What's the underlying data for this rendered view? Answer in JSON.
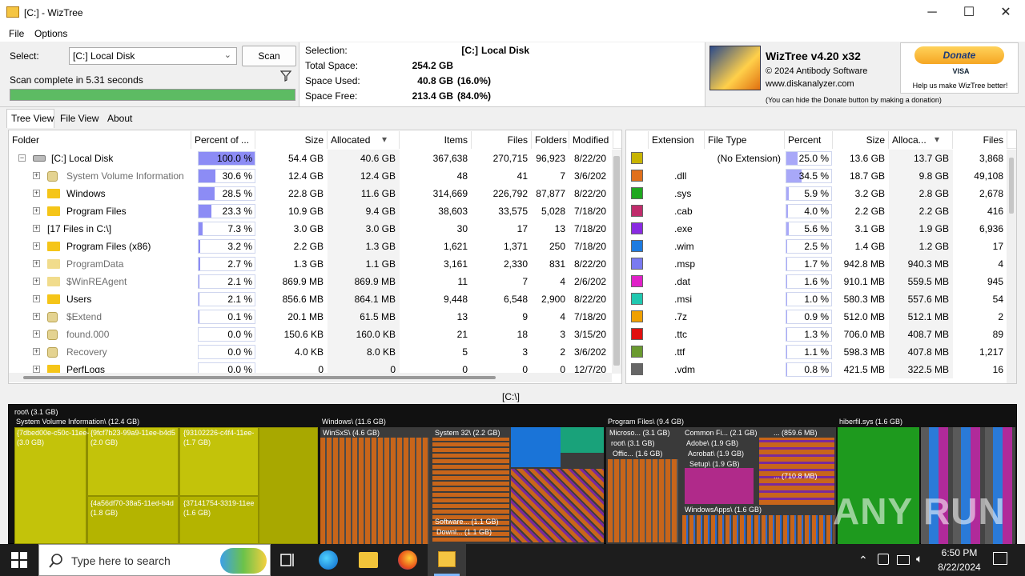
{
  "window": {
    "title": "[C:]  - WizTree",
    "minimize": "─",
    "maximize": "☐",
    "close": "✕"
  },
  "menu": [
    "File",
    "Options"
  ],
  "select": {
    "label": "Select:",
    "drive": "[C:] Local Disk",
    "scan_label": "Scan",
    "status": "Scan complete in 5.31 seconds",
    "progress": 1.0
  },
  "info": {
    "selection_label": "Selection:",
    "selection_drive": "[C:]",
    "selection_name": "Local Disk",
    "total_label": "Total Space:",
    "total": "254.2 GB",
    "used_label": "Space Used:",
    "used": "40.8 GB",
    "used_pct": "(16.0%)",
    "free_label": "Space Free:",
    "free": "213.4 GB",
    "free_pct": "(84.0%)"
  },
  "about": {
    "version": "WizTree v4.20 x32",
    "copyright": "© 2024 Antibody Software",
    "site": "www.diskanalyzer.com",
    "hide_note": "(You can hide the Donate button by making a donation)"
  },
  "donate": {
    "label": "Donate",
    "cards": "VISA",
    "help": "Help us make WizTree better!"
  },
  "tabs": [
    "Tree View",
    "File View",
    "About"
  ],
  "tree": {
    "columns": [
      "Folder",
      "Percent of ...",
      "Size",
      "Allocated",
      "Items",
      "Files",
      "Folders",
      "Modified"
    ],
    "rows": [
      {
        "name": "[C:] Local Disk",
        "pct": "100.0 %",
        "pctv": 1.0,
        "size": "54.4 GB",
        "alloc": "40.6 GB",
        "items": "367,638",
        "files": "270,715",
        "folders": "96,923",
        "mod": "8/22/20",
        "icon": "drive"
      },
      {
        "name": "System Volume Information",
        "pct": "30.6 %",
        "pctv": 0.306,
        "size": "12.4 GB",
        "alloc": "12.4 GB",
        "items": "48",
        "files": "41",
        "folders": "7",
        "mod": "3/6/202",
        "icon": "sys",
        "dim": true
      },
      {
        "name": "Windows",
        "pct": "28.5 %",
        "pctv": 0.285,
        "size": "22.8 GB",
        "alloc": "11.6 GB",
        "items": "314,669",
        "files": "226,792",
        "folders": "87,877",
        "mod": "8/22/20",
        "icon": "folder"
      },
      {
        "name": "Program Files",
        "pct": "23.3 %",
        "pctv": 0.233,
        "size": "10.9 GB",
        "alloc": "9.4 GB",
        "items": "38,603",
        "files": "33,575",
        "folders": "5,028",
        "mod": "7/18/20",
        "icon": "folder"
      },
      {
        "name": "[17 Files in C:\\]",
        "pct": "7.3 %",
        "pctv": 0.073,
        "size": "3.0 GB",
        "alloc": "3.0 GB",
        "items": "30",
        "files": "17",
        "folders": "13",
        "mod": "7/18/20",
        "icon": "none"
      },
      {
        "name": "Program Files (x86)",
        "pct": "3.2 %",
        "pctv": 0.032,
        "size": "2.2 GB",
        "alloc": "1.3 GB",
        "items": "1,621",
        "files": "1,371",
        "folders": "250",
        "mod": "7/18/20",
        "icon": "folder"
      },
      {
        "name": "ProgramData",
        "pct": "2.7 %",
        "pctv": 0.027,
        "size": "1.3 GB",
        "alloc": "1.1 GB",
        "items": "3,161",
        "files": "2,330",
        "folders": "831",
        "mod": "8/22/20",
        "icon": "folderdim",
        "dim": true
      },
      {
        "name": "$WinREAgent",
        "pct": "2.1 %",
        "pctv": 0.021,
        "size": "869.9 MB",
        "alloc": "869.9 MB",
        "items": "11",
        "files": "7",
        "folders": "4",
        "mod": "2/6/202",
        "icon": "folderdim",
        "dim": true
      },
      {
        "name": "Users",
        "pct": "2.1 %",
        "pctv": 0.021,
        "size": "856.6 MB",
        "alloc": "864.1 MB",
        "items": "9,448",
        "files": "6,548",
        "folders": "2,900",
        "mod": "8/22/20",
        "icon": "folder"
      },
      {
        "name": "$Extend",
        "pct": "0.1 %",
        "pctv": 0.001,
        "size": "20.1 MB",
        "alloc": "61.5 MB",
        "items": "13",
        "files": "9",
        "folders": "4",
        "mod": "7/18/20",
        "icon": "sys",
        "dim": true
      },
      {
        "name": "found.000",
        "pct": "0.0 %",
        "pctv": 0.0,
        "size": "150.6 KB",
        "alloc": "160.0 KB",
        "items": "21",
        "files": "18",
        "folders": "3",
        "mod": "3/15/20",
        "icon": "sys",
        "dim": true
      },
      {
        "name": "Recovery",
        "pct": "0.0 %",
        "pctv": 0.0,
        "size": "4.0 KB",
        "alloc": "8.0 KB",
        "items": "5",
        "files": "3",
        "folders": "2",
        "mod": "3/6/202",
        "icon": "sys",
        "dim": true
      },
      {
        "name": "PerfLogs",
        "pct": "0.0 %",
        "pctv": 0.0,
        "size": "0",
        "alloc": "0",
        "items": "0",
        "files": "0",
        "folders": "0",
        "mod": "12/7/20",
        "icon": "folder"
      }
    ]
  },
  "ext": {
    "columns": [
      "Extension",
      "File Type",
      "Percent",
      "Size",
      "Alloca...",
      "Files"
    ],
    "rows": [
      {
        "ext": "",
        "type": "(No Extension)",
        "pct": "25.0 %",
        "pctv": 0.25,
        "size": "13.6 GB",
        "alloc": "13.7 GB",
        "files": "3,868",
        "color": "#c8b400"
      },
      {
        "ext": ".dll",
        "type": "",
        "pct": "34.5 %",
        "pctv": 0.345,
        "size": "18.7 GB",
        "alloc": "9.8 GB",
        "files": "49,108",
        "color": "#e0701c"
      },
      {
        "ext": ".sys",
        "type": "",
        "pct": "5.9 %",
        "pctv": 0.059,
        "size": "3.2 GB",
        "alloc": "2.8 GB",
        "files": "2,678",
        "color": "#1fa81f"
      },
      {
        "ext": ".cab",
        "type": "",
        "pct": "4.0 %",
        "pctv": 0.04,
        "size": "2.2 GB",
        "alloc": "2.2 GB",
        "files": "416",
        "color": "#c02c6c"
      },
      {
        "ext": ".exe",
        "type": "",
        "pct": "5.6 %",
        "pctv": 0.056,
        "size": "3.1 GB",
        "alloc": "1.9 GB",
        "files": "6,936",
        "color": "#8a2be2"
      },
      {
        "ext": ".wim",
        "type": "",
        "pct": "2.5 %",
        "pctv": 0.025,
        "size": "1.4 GB",
        "alloc": "1.2 GB",
        "files": "17",
        "color": "#1e7be0"
      },
      {
        "ext": ".msp",
        "type": "",
        "pct": "1.7 %",
        "pctv": 0.017,
        "size": "942.8 MB",
        "alloc": "940.3 MB",
        "files": "4",
        "color": "#7a7af0"
      },
      {
        "ext": ".dat",
        "type": "",
        "pct": "1.6 %",
        "pctv": 0.016,
        "size": "910.1 MB",
        "alloc": "559.5 MB",
        "files": "945",
        "color": "#e020c8"
      },
      {
        "ext": ".msi",
        "type": "",
        "pct": "1.0 %",
        "pctv": 0.01,
        "size": "580.3 MB",
        "alloc": "557.6 MB",
        "files": "54",
        "color": "#20c8b0"
      },
      {
        "ext": ".7z",
        "type": "",
        "pct": "0.9 %",
        "pctv": 0.009,
        "size": "512.0 MB",
        "alloc": "512.1 MB",
        "files": "2",
        "color": "#f0a000"
      },
      {
        "ext": ".ttc",
        "type": "",
        "pct": "1.3 %",
        "pctv": 0.013,
        "size": "706.0 MB",
        "alloc": "408.7 MB",
        "files": "89",
        "color": "#e01010"
      },
      {
        "ext": ".ttf",
        "type": "",
        "pct": "1.1 %",
        "pctv": 0.011,
        "size": "598.3 MB",
        "alloc": "407.8 MB",
        "files": "1,217",
        "color": "#6a9a30"
      },
      {
        "ext": ".vdm",
        "type": "",
        "pct": "0.8 %",
        "pctv": 0.008,
        "size": "421.5 MB",
        "alloc": "322.5 MB",
        "files": "16",
        "color": "#666666"
      }
    ]
  },
  "path": "[C:\\]",
  "treemap": {
    "root": "root\\  (3.1 GB)",
    "svi": "System Volume Information\\  (12.4 GB)",
    "svi1": "{7dbed00e-c50c-11ee-",
    "svi1s": "(3.0 GB)",
    "svi2": "{9fcf7b23-99a9-11ee-b4d5",
    "svi2s": "(2.0 GB)",
    "svi3": "{93102226-c4f4-11ee-",
    "svi3s": "(1.7 GB)",
    "svi4": "{4a56df70-38a5-11ed-b4d",
    "svi4s": "(1.8 GB)",
    "svi5": "{37141754-3319-11ee",
    "svi5s": "(1.6 GB)",
    "windows": "Windows\\  (11.6 GB)",
    "winsxs": "WinSxS\\  (4.6 GB)",
    "system32": "System 32\\  (2.2 GB)",
    "software": "Software...  (1.1 GB)",
    "downl": "Downl...  (1.1 GB)",
    "pf": "Program Files\\  (9.4 GB)",
    "micro": "Microso...  (3.1 GB)",
    "offic": "Offic...  (1.6 GB)",
    "common": "Common Fi...  (2.1 GB)",
    "adobe": "Adobe\\  (1.9 GB)",
    "acrobat": "Acrobat\\  (1.9 GB)",
    "setup": "Setup\\  (1.9 GB)",
    "dots1": "...  (859.6 MB)",
    "dots2": "...  (710.8 MB)",
    "winapps": "WindowsApps\\  (1.6 GB)",
    "hiber": "hiberfil.sys  (1.6 GB)"
  },
  "taskbar": {
    "search_placeholder": "Type here to search",
    "time": "6:50 PM",
    "date": "8/22/2024"
  },
  "watermark": "ANY RUN"
}
